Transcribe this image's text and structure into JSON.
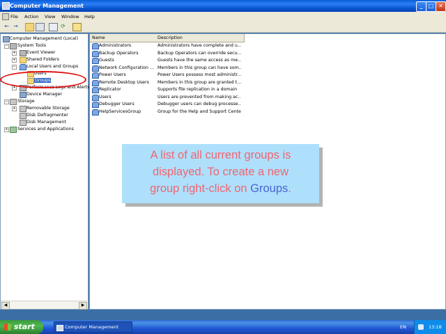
{
  "window": {
    "title": "Computer Management",
    "controls": {
      "minimize": "_",
      "maximize": "□",
      "close": "✕"
    }
  },
  "menu": [
    "File",
    "Action",
    "View",
    "Window",
    "Help"
  ],
  "toolbar": {
    "icons": [
      "back-icon",
      "forward-icon",
      "up-folder-icon",
      "show-hide-tree-icon",
      "properties-icon",
      "refresh-icon",
      "help-icon"
    ]
  },
  "tree": {
    "root": "Computer Management (Local)",
    "system_tools": "System Tools",
    "event_viewer": "Event Viewer",
    "shared_folders": "Shared Folders",
    "local_users_groups": "Local Users and Groups",
    "users": "Users",
    "groups": "Groups",
    "perf_logs": "Performance Logs and Alerts",
    "device_manager": "Device Manager",
    "storage": "Storage",
    "removable_storage": "Removable Storage",
    "disk_defrag": "Disk Defragmenter",
    "disk_mgmt": "Disk Management",
    "services": "Services and Applications"
  },
  "list": {
    "columns": [
      "Name",
      "Description"
    ],
    "rows": [
      {
        "name": "Administrators",
        "desc": "Administrators have complete and u..."
      },
      {
        "name": "Backup Operators",
        "desc": "Backup Operators can override secu..."
      },
      {
        "name": "Guests",
        "desc": "Guests have the same access as me..."
      },
      {
        "name": "Network Configuration ...",
        "desc": "Members in this group can have som..."
      },
      {
        "name": "Power Users",
        "desc": "Power Users possess most administr..."
      },
      {
        "name": "Remote Desktop Users",
        "desc": "Members in this group are granted t..."
      },
      {
        "name": "Replicator",
        "desc": "Supports file replication in a domain"
      },
      {
        "name": "Users",
        "desc": "Users are prevented from making ac..."
      },
      {
        "name": "Debugger Users",
        "desc": "Debugger users can debug processe..."
      },
      {
        "name": "HelpServicesGroup",
        "desc": "Group for the Help and Support Center"
      }
    ]
  },
  "callout": {
    "line1": "A list of all current groups is",
    "line2": "displayed. To create a new",
    "line3_pre": "group right-click on ",
    "line3_link": "Groups",
    "line3_post": "."
  },
  "taskbar": {
    "start": "start",
    "task": "Computer Management",
    "language": "EN",
    "clock": "13:18"
  },
  "colors": {
    "titlebar": "#0a5fd8",
    "callout_bg": "#aee0fc",
    "callout_text": "#f26470",
    "callout_link": "#4a64d6",
    "highlight": "#e01010",
    "selection": "#316ac5"
  }
}
